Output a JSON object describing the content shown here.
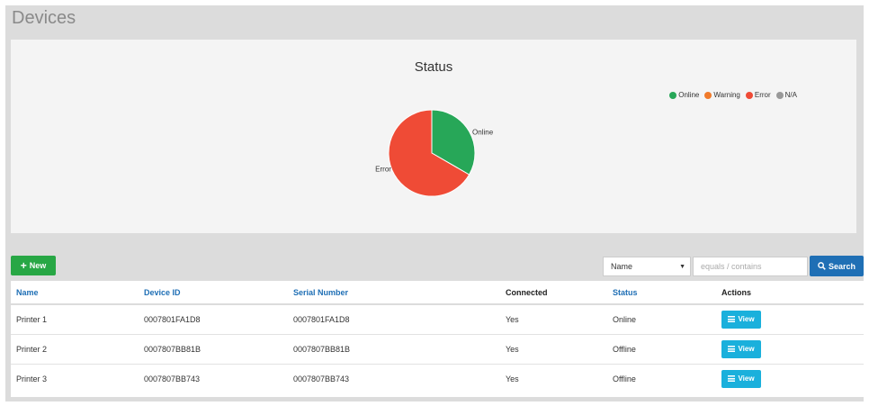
{
  "page": {
    "title": "Devices"
  },
  "chart_data": {
    "type": "pie",
    "title": "Status",
    "legend": {
      "placement": "top-right",
      "entries": [
        {
          "name": "Online",
          "color": "#27a758"
        },
        {
          "name": "Warning",
          "color": "#f07a2a"
        },
        {
          "name": "Error",
          "color": "#ef4b36"
        },
        {
          "name": "N/A",
          "color": "#999999"
        }
      ]
    },
    "slices": [
      {
        "label": "Online",
        "value": 1,
        "color": "#27a758"
      },
      {
        "label": "Error",
        "value": 2,
        "color": "#ef4b36"
      }
    ]
  },
  "toolbar": {
    "new_label": "New",
    "filter_field": "Name",
    "filter_placeholder": "equals / contains",
    "search_label": "Search"
  },
  "table": {
    "columns": [
      "Name",
      "Device ID",
      "Serial Number",
      "Connected",
      "Status",
      "Actions"
    ],
    "rows": [
      {
        "name": "Printer 1",
        "device_id": "0007801FA1D8",
        "serial": "0007801FA1D8",
        "connected": "Yes",
        "status": "Online",
        "action": "View"
      },
      {
        "name": "Printer 2",
        "device_id": "0007807BB81B",
        "serial": "0007807BB81B",
        "connected": "Yes",
        "status": "Offline",
        "action": "View"
      },
      {
        "name": "Printer 3",
        "device_id": "0007807BB743",
        "serial": "0007807BB743",
        "connected": "Yes",
        "status": "Offline",
        "action": "View"
      }
    ]
  }
}
